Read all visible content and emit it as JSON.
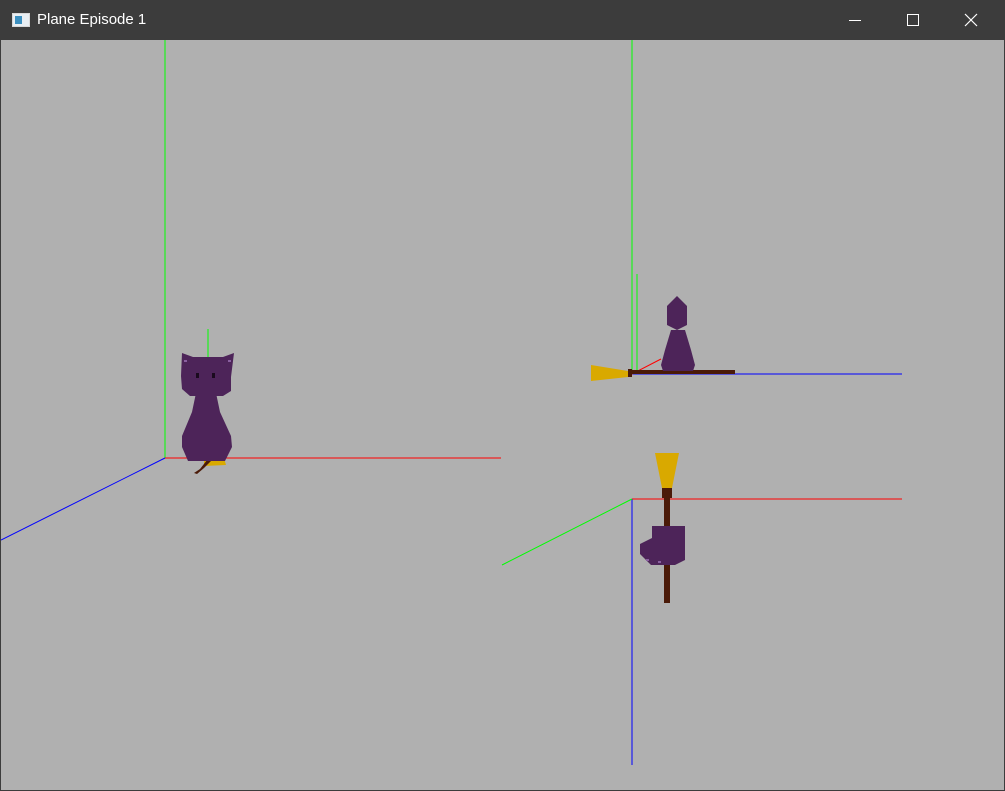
{
  "window": {
    "title": "Plane Episode 1",
    "icon": "app-window-icon",
    "controls": [
      "minimize-icon",
      "maximize-icon",
      "close-icon"
    ]
  },
  "scene": {
    "background_color": "#b0b0b0",
    "axis_colors": {
      "x": "#ff0000",
      "y": "#00ff00",
      "z": "#0000ff"
    },
    "character_color": "#4d2459",
    "broom_handle_color": "#4a1a08",
    "broom_bristle_color": "#d9a900",
    "views": [
      "perspective-view",
      "side-view",
      "top-view"
    ]
  }
}
